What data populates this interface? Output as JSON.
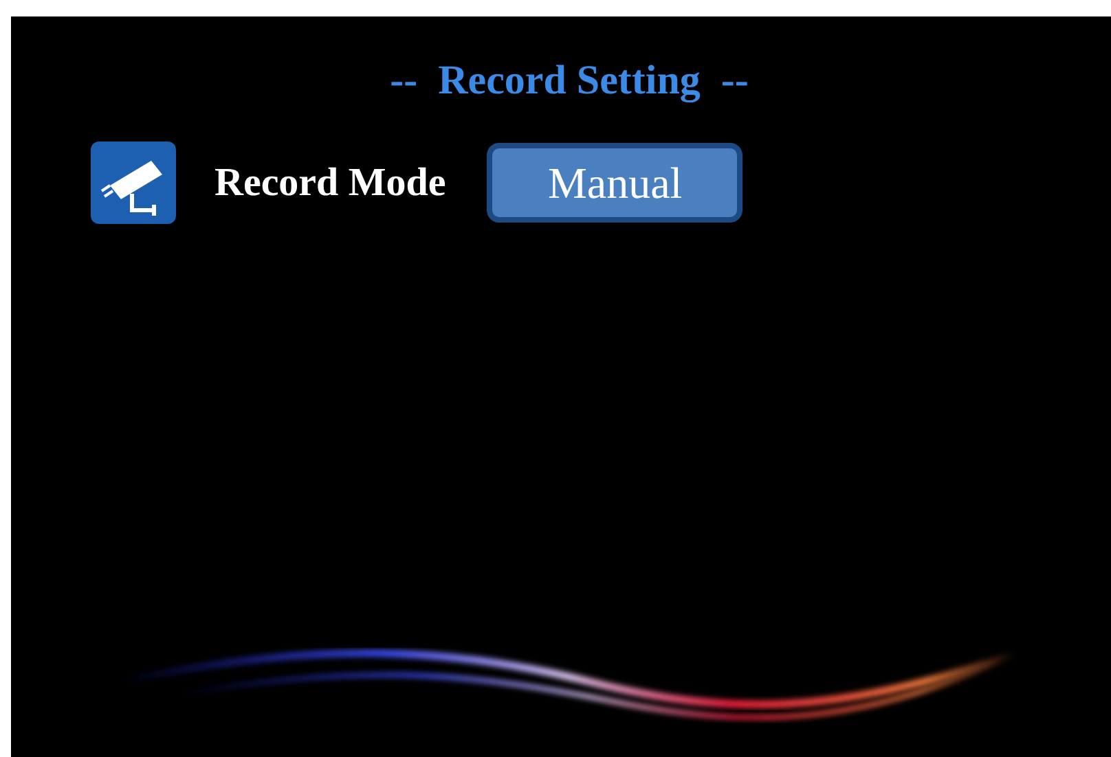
{
  "title": "--  Record Setting  --",
  "settings": [
    {
      "label": "Record Mode",
      "value": "Manual",
      "selected": true
    }
  ]
}
